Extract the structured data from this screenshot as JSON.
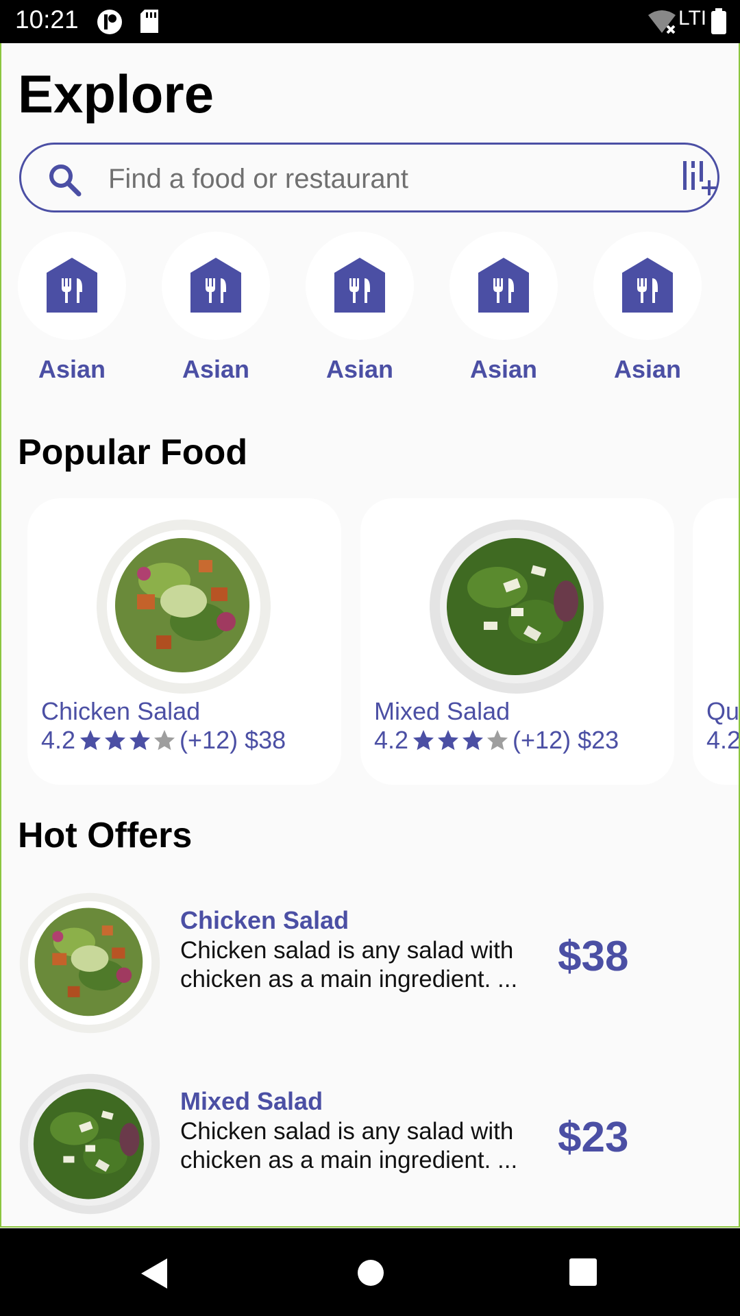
{
  "status_bar": {
    "time": "10:21",
    "network": "LTI"
  },
  "page": {
    "title": "Explore"
  },
  "search": {
    "placeholder": "Find a food or restaurant"
  },
  "categories": [
    {
      "label": "Asian"
    },
    {
      "label": "Asian"
    },
    {
      "label": "Asian"
    },
    {
      "label": "Asian"
    },
    {
      "label": "Asian"
    }
  ],
  "popular": {
    "heading": "Popular Food",
    "items": [
      {
        "name": "Chicken Salad",
        "rating": "4.2",
        "stars": 3,
        "reviews": "(+12)",
        "price": "$38"
      },
      {
        "name": "Mixed Salad",
        "rating": "4.2",
        "stars": 3,
        "reviews": "(+12)",
        "price": "$23"
      },
      {
        "name": "Qu",
        "rating": "4.2"
      }
    ]
  },
  "offers": {
    "heading": "Hot Offers",
    "items": [
      {
        "name": "Chicken Salad",
        "desc_line1": "Chicken salad is any salad with",
        "desc_line2": "chicken as a main ingredient. ...",
        "price": "$38"
      },
      {
        "name": "Mixed Salad",
        "desc_line1": "Chicken salad is any salad with",
        "desc_line2": "chicken as a main ingredient. ...",
        "price": "$23"
      }
    ]
  },
  "colors": {
    "accent": "#4b4fa4",
    "background": "#fafafa",
    "card": "#ffffff",
    "star_empty": "#9e9e9e"
  },
  "icons": [
    "search-icon",
    "filter-icon",
    "restaurant-icon",
    "star-icon",
    "back-icon",
    "home-icon",
    "recents-icon"
  ]
}
